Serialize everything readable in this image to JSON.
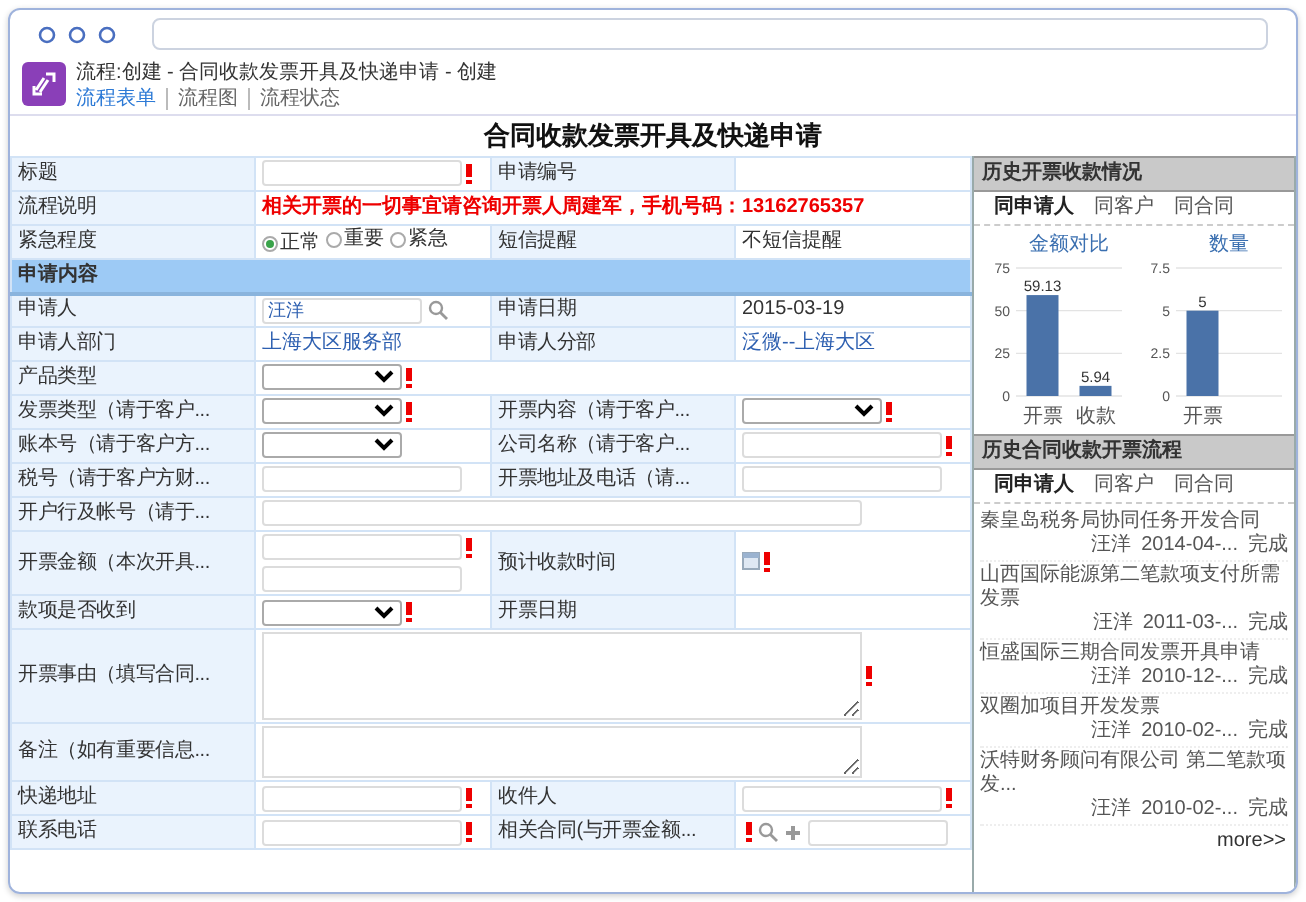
{
  "header": {
    "title": "流程:创建 - 合同收款发票开具及快递申请 - 创建",
    "tabs": [
      {
        "label": "流程表单",
        "selected": true
      },
      {
        "label": "流程图",
        "selected": false
      },
      {
        "label": "流程状态",
        "selected": false
      }
    ]
  },
  "form": {
    "title": "合同收款发票开具及快递申请",
    "rows": [
      {
        "kind": "pair",
        "cells": [
          {
            "label": "标题",
            "control": {
              "kind": "input",
              "required": true
            }
          },
          {
            "label": "申请编号"
          }
        ]
      },
      {
        "kind": "pair",
        "cells": [
          {
            "label": "流程说明",
            "control": {
              "kind": "notice",
              "value": "相关开票的一切事宜请咨询开票人周建军，手机号码：13162765357"
            }
          }
        ]
      },
      {
        "kind": "pair",
        "cells": [
          {
            "label": "紧急程度",
            "control": {
              "kind": "radios",
              "options": [
                {
                  "label": "正常",
                  "selected": true
                },
                {
                  "label": "重要",
                  "selected": false
                },
                {
                  "label": "紧急",
                  "selected": false
                }
              ]
            }
          },
          {
            "label": "短信提醒",
            "control": {
              "kind": "text",
              "value": "不短信提醒"
            }
          }
        ]
      },
      {
        "kind": "section",
        "label": "申请内容"
      },
      {
        "kind": "pair",
        "cells": [
          {
            "label": "申请人",
            "control": {
              "kind": "lookup",
              "value": "汪洋",
              "required": false
            }
          },
          {
            "label": "申请日期",
            "control": {
              "kind": "text",
              "value": "2015-03-19"
            }
          }
        ]
      },
      {
        "kind": "pair",
        "cells": [
          {
            "label": "申请人部门",
            "control": {
              "kind": "link",
              "value": "上海大区服务部"
            }
          },
          {
            "label": "申请人分部",
            "control": {
              "kind": "link",
              "value": "泛微--上海大区"
            }
          }
        ]
      },
      {
        "kind": "pair",
        "cells": [
          {
            "label": "产品类型",
            "control": {
              "kind": "select",
              "required": true
            }
          }
        ]
      },
      {
        "kind": "pair",
        "cells": [
          {
            "label": "发票类型（请于客户...",
            "control": {
              "kind": "select",
              "required": true
            }
          },
          {
            "label": "开票内容（请于客户...",
            "control": {
              "kind": "select",
              "required": true
            }
          }
        ]
      },
      {
        "kind": "pair",
        "cells": [
          {
            "label": "账本号（请于客户方...",
            "control": {
              "kind": "select",
              "required": false
            }
          },
          {
            "label": "公司名称（请于客户...",
            "control": {
              "kind": "input",
              "required": true
            }
          }
        ]
      },
      {
        "kind": "pair",
        "cells": [
          {
            "label": "税号（请于客户方财...",
            "control": {
              "kind": "input",
              "required": false
            }
          },
          {
            "label": "开票地址及电话（请...",
            "control": {
              "kind": "input",
              "required": false
            }
          }
        ]
      },
      {
        "kind": "pair",
        "cells": [
          {
            "label": "开户行及帐号（请于...",
            "control": {
              "kind": "input",
              "required": false
            }
          }
        ]
      },
      {
        "kind": "pair",
        "cells": [
          {
            "label": "开票金额（本次开具...",
            "control": {
              "kind": "double-input",
              "required": true
            }
          },
          {
            "label": "预计收款时间",
            "control": {
              "kind": "date",
              "required": true
            }
          }
        ]
      },
      {
        "kind": "pair",
        "cells": [
          {
            "label": "款项是否收到",
            "control": {
              "kind": "select",
              "required": true
            }
          },
          {
            "label": "开票日期"
          }
        ]
      },
      {
        "kind": "pair",
        "cells": [
          {
            "label": "开票事由（填写合同...",
            "control": {
              "kind": "textarea",
              "required": true
            }
          }
        ]
      },
      {
        "kind": "pair",
        "cells": [
          {
            "label": "备注（如有重要信息...",
            "control": {
              "kind": "textarea",
              "required": false
            }
          }
        ]
      },
      {
        "kind": "pair",
        "cells": [
          {
            "label": "快递地址",
            "control": {
              "kind": "input",
              "required": true
            }
          },
          {
            "label": "收件人",
            "control": {
              "kind": "input",
              "required": true
            }
          }
        ]
      },
      {
        "kind": "pair",
        "cells": [
          {
            "label": "联系电话",
            "control": {
              "kind": "input",
              "required": true
            }
          },
          {
            "label": "相关合同(与开票金额...",
            "control": {
              "kind": "browse",
              "required": true
            }
          }
        ]
      }
    ]
  },
  "history_panel": {
    "title": "历史开票收款情况",
    "tabs": [
      {
        "label": "同申请人",
        "selected": true
      },
      {
        "label": "同客户",
        "selected": false
      },
      {
        "label": "同合同",
        "selected": false
      }
    ],
    "charts": [
      {
        "chart_data": {
          "type": "bar",
          "title": "金额对比",
          "categories": [
            "开票",
            "收款"
          ],
          "values": [
            59.13,
            5.94
          ],
          "ylim": [
            0,
            75
          ],
          "yticks": [
            0,
            25,
            50,
            75
          ],
          "data_labels": true
        }
      },
      {
        "chart_data": {
          "type": "bar",
          "title": "数量",
          "categories": [
            "开票"
          ],
          "values": [
            5
          ],
          "ylim": [
            0,
            7.5
          ],
          "yticks": [
            0,
            2.5,
            5,
            7.5
          ],
          "data_labels": true
        }
      }
    ]
  },
  "process_panel": {
    "title": "历史合同收款开票流程",
    "tabs": [
      {
        "label": "同申请人",
        "selected": true
      },
      {
        "label": "同客户",
        "selected": false
      },
      {
        "label": "同合同",
        "selected": false
      }
    ],
    "items": [
      {
        "name": "秦皇岛税务局协同任务开发合同",
        "person": "汪洋",
        "date": "2014-04-...",
        "status": "完成"
      },
      {
        "name": "山西国际能源第二笔款项支付所需发票",
        "person": "汪洋",
        "date": "2011-03-...",
        "status": "完成"
      },
      {
        "name": "恒盛国际三期合同发票开具申请",
        "person": "汪洋",
        "date": "2010-12-...",
        "status": "完成"
      },
      {
        "name": "双圈加项目开发发票",
        "person": "汪洋",
        "date": "2010-02-...",
        "status": "完成"
      },
      {
        "name": "沃特财务顾问有限公司 第二笔款项发...",
        "person": "汪洋",
        "date": "2010-02-...",
        "status": "完成"
      }
    ],
    "more": "more>>"
  }
}
